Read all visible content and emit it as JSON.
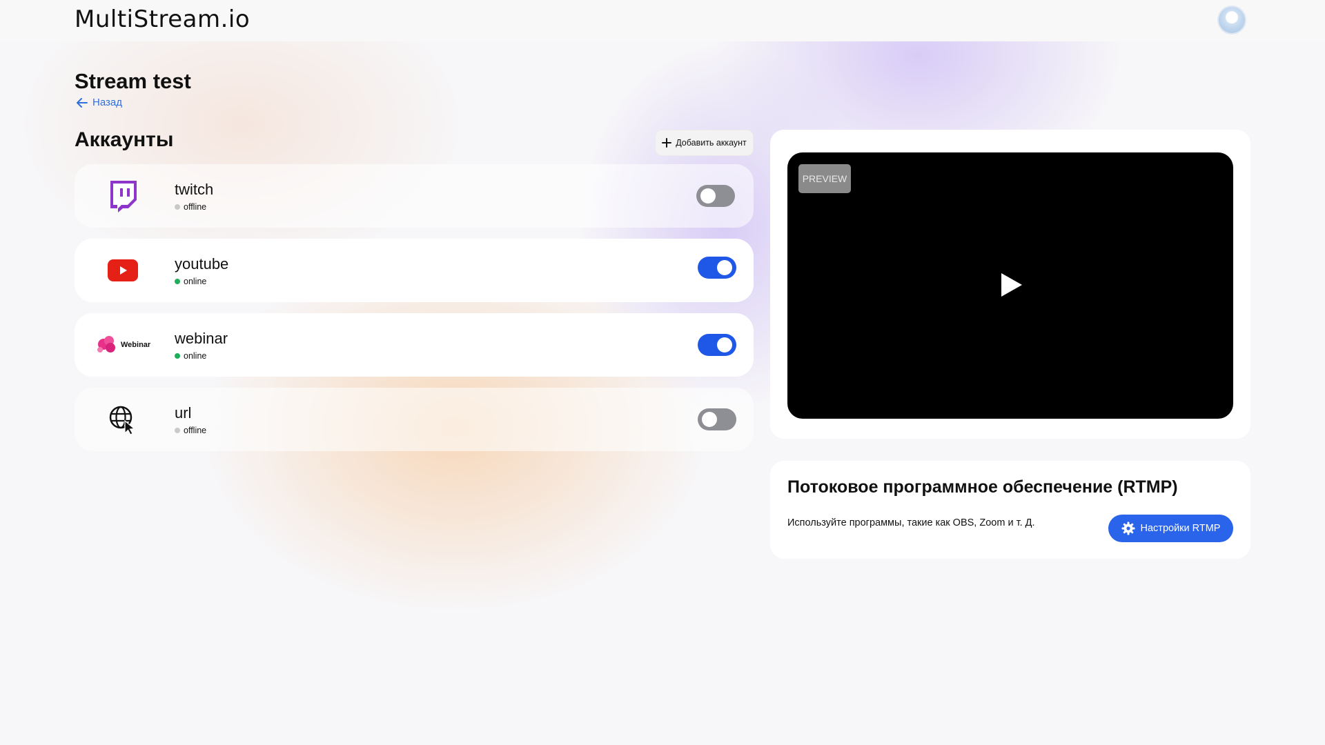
{
  "header": {
    "logo_text": "MultiStream.io",
    "avatar_icon": "user-avatar"
  },
  "page": {
    "title": "Stream test",
    "back_label": "Назад"
  },
  "accounts": {
    "title": "Аккаунты",
    "add_label": "Добавить аккаунт",
    "items": [
      {
        "name": "twitch",
        "status": "offline",
        "enabled": false,
        "logo": "twitch-logo"
      },
      {
        "name": "youtube",
        "status": "online",
        "enabled": true,
        "logo": "youtube-logo"
      },
      {
        "name": "webinar",
        "status": "online",
        "enabled": true,
        "logo": "webinar-logo",
        "logo_text": "Webinar"
      },
      {
        "name": "url",
        "status": "offline",
        "enabled": false,
        "logo": "globe-cursor-icon"
      }
    ]
  },
  "preview": {
    "tag": "PREVIEW",
    "play_icon": "play-icon"
  },
  "rtmp": {
    "title": "Потоковое программное обеспечение (RTMP)",
    "description": "Используйте  программы, такие как OBS, Zoom и т. Д.",
    "button_label": "Настройки RTMP",
    "button_icon": "gear-icon"
  },
  "colors": {
    "accent": "#1f57e6",
    "online": "#1fae5b",
    "offline": "#c9c9c9",
    "twitch": "#9146ff",
    "youtube": "#ff0000",
    "link": "#2f6fdc"
  }
}
